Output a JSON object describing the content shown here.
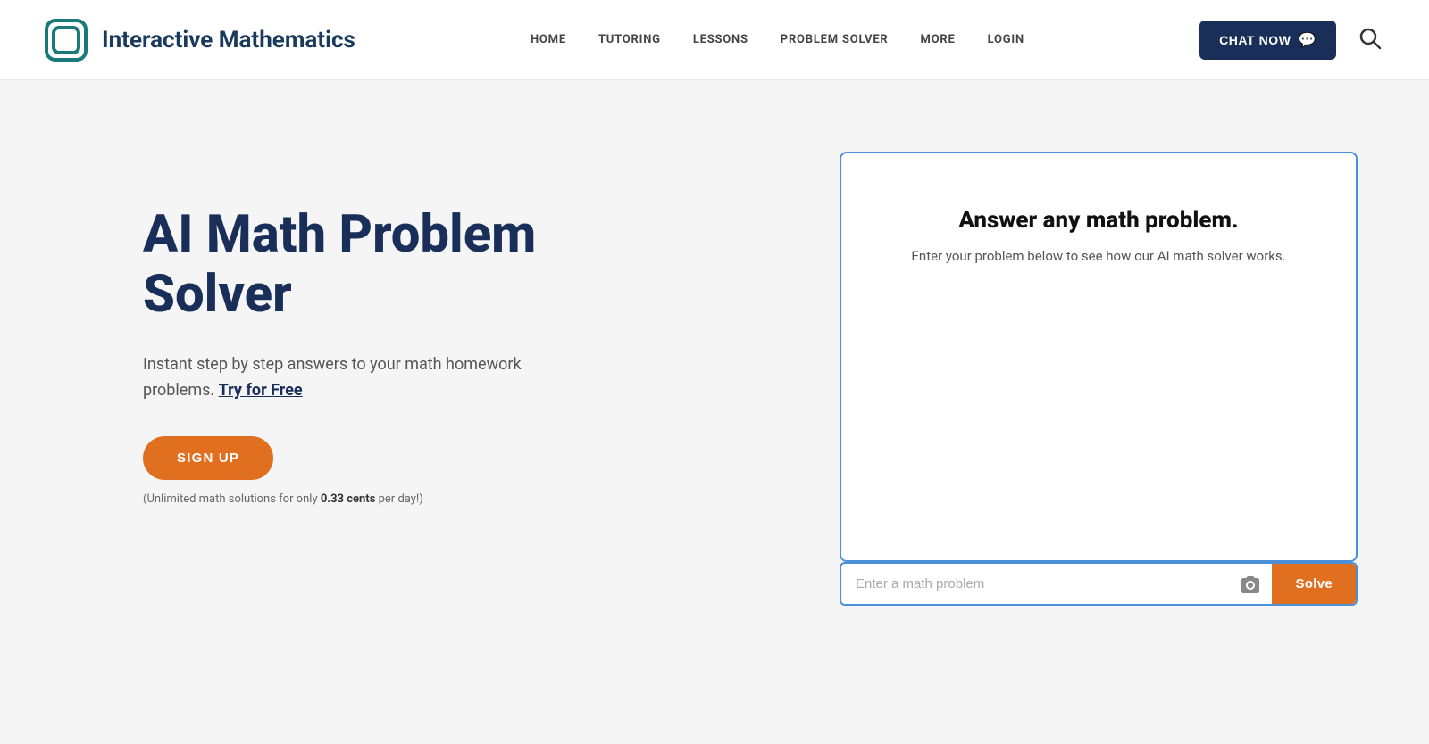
{
  "header": {
    "logo_text": "Interactive Mathematics",
    "nav_items": [
      {
        "label": "HOME",
        "id": "home"
      },
      {
        "label": "TUTORING",
        "id": "tutoring"
      },
      {
        "label": "LESSONS",
        "id": "lessons"
      },
      {
        "label": "PROBLEM SOLVER",
        "id": "problem-solver"
      },
      {
        "label": "MORE",
        "id": "more"
      },
      {
        "label": "LOGIN",
        "id": "login"
      }
    ],
    "chat_now_label": "CHAT NOW",
    "search_label": "Search"
  },
  "hero": {
    "title": "AI Math Problem Solver",
    "subtitle_text": "Instant step by step answers to your math homework problems.",
    "try_free_label": "Try for Free",
    "signup_label": "SIGN UP",
    "pricing_note_prefix": "(Unlimited math solutions for only ",
    "pricing_bold": "0.33 cents",
    "pricing_note_suffix": " per day!)"
  },
  "solver": {
    "card_title": "Answer any math problem.",
    "card_subtitle": "Enter your problem below to see how our AI math solver works.",
    "input_placeholder": "Enter a math problem",
    "solve_button_label": "Solve"
  },
  "colors": {
    "brand_dark": "#1a2e5a",
    "accent_orange": "#e07020",
    "accent_blue": "#4a90d9",
    "logo_teal": "#1a7a7a"
  }
}
